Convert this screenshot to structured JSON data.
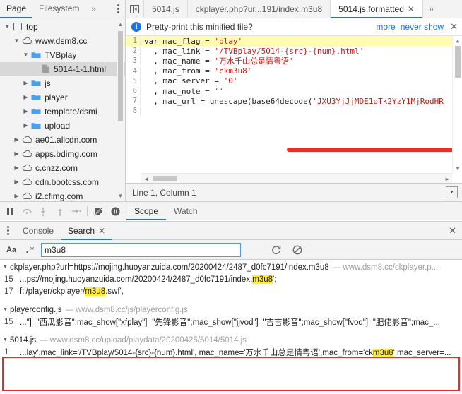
{
  "navigator": {
    "tabs": [
      {
        "label": "Page",
        "active": true
      },
      {
        "label": "Filesystem",
        "active": false
      }
    ],
    "overflow_icon": "chevron-double-right-icon",
    "menu_icon": "kebab-menu-icon",
    "tree": [
      {
        "label": "top",
        "icon": "frame-icon",
        "depth": 0,
        "twisty": "open",
        "selected": false
      },
      {
        "label": "www.dsm8.cc",
        "icon": "cloud-icon",
        "depth": 1,
        "twisty": "open",
        "selected": false
      },
      {
        "label": "TVBplay",
        "icon": "folder-icon",
        "depth": 2,
        "twisty": "open",
        "selected": false
      },
      {
        "label": "5014-1-1.html",
        "icon": "file-icon",
        "depth": 3,
        "twisty": "none",
        "selected": true
      },
      {
        "label": "js",
        "icon": "folder-icon",
        "depth": 2,
        "twisty": "closed",
        "selected": false
      },
      {
        "label": "player",
        "icon": "folder-icon",
        "depth": 2,
        "twisty": "closed",
        "selected": false
      },
      {
        "label": "template/dsmi",
        "icon": "folder-icon",
        "depth": 2,
        "twisty": "closed",
        "selected": false
      },
      {
        "label": "upload",
        "icon": "folder-icon",
        "depth": 2,
        "twisty": "closed",
        "selected": false
      },
      {
        "label": "ae01.alicdn.com",
        "icon": "cloud-icon",
        "depth": 1,
        "twisty": "closed",
        "selected": false
      },
      {
        "label": "apps.bdimg.com",
        "icon": "cloud-icon",
        "depth": 1,
        "twisty": "closed",
        "selected": false
      },
      {
        "label": "c.cnzz.com",
        "icon": "cloud-icon",
        "depth": 1,
        "twisty": "closed",
        "selected": false
      },
      {
        "label": "cdn.bootcss.com",
        "icon": "cloud-icon",
        "depth": 1,
        "twisty": "closed",
        "selected": false
      },
      {
        "label": "i2.cfimg.com",
        "icon": "cloud-icon",
        "depth": 1,
        "twisty": "closed",
        "selected": false
      }
    ]
  },
  "debugger_toolbar": {
    "buttons": [
      {
        "name": "pause-script-execution",
        "icon": "pause-icon",
        "state": "active"
      },
      {
        "name": "step-over-next-function-call",
        "icon": "step-over-icon",
        "state": "disabled"
      },
      {
        "name": "step-into-next-function-call",
        "icon": "step-into-icon",
        "state": "disabled"
      },
      {
        "name": "step-out-of-current-function",
        "icon": "step-out-icon",
        "state": "disabled"
      },
      {
        "name": "step",
        "icon": "step-icon",
        "state": "disabled"
      },
      {
        "name": "deactivate-breakpoints",
        "icon": "breakpoint-slash-icon",
        "state": "active"
      },
      {
        "name": "pause-on-exceptions",
        "icon": "pause-circle-icon",
        "state": "active"
      }
    ]
  },
  "sources": {
    "panel_toggle_icon": "show-navigator-icon",
    "tabs": [
      {
        "label": "5014.js",
        "active": false,
        "closable": false
      },
      {
        "label": "ckplayer.php?ur...191/index.m3u8",
        "active": false,
        "closable": false
      },
      {
        "label": "5014.js:formatted",
        "active": true,
        "closable": true
      }
    ],
    "overflow_icon": "chevron-double-right-icon",
    "infobar": {
      "icon": "info-icon",
      "message": "Pretty-print this minified file?",
      "more_label": "more",
      "never_show_label": "never show",
      "close_icon": "close-icon"
    },
    "code_lines": [
      {
        "no": "1",
        "highlighted": true,
        "text": "var mac_flag = 'play'"
      },
      {
        "no": "2",
        "highlighted": false,
        "text": "  , mac_link = '/TVBplay/5014-{src}-{num}.html'"
      },
      {
        "no": "3",
        "highlighted": false,
        "text": "  , mac_name = '万水千山总是情粤语'"
      },
      {
        "no": "4",
        "highlighted": false,
        "text": "  , mac_from = 'ckm3u8'"
      },
      {
        "no": "5",
        "highlighted": false,
        "text": "  , mac_server = '0'"
      },
      {
        "no": "6",
        "highlighted": false,
        "text": "  , mac_note = ''"
      },
      {
        "no": "7",
        "highlighted": false,
        "text": "  , mac_url = unescape(base64decode('JXU3YjJjMDE1dTk2YzY1MjRodHR"
      },
      {
        "no": "8",
        "highlighted": false,
        "text": ""
      }
    ],
    "status_text": "Line 1, Column 1",
    "status_button_icon": "show-console-drawer-icon"
  },
  "sidepane": {
    "tabs": [
      {
        "label": "Scope",
        "active": true
      },
      {
        "label": "Watch",
        "active": false
      }
    ]
  },
  "drawer": {
    "menu_icon": "kebab-menu-icon",
    "tabs": [
      {
        "label": "Console",
        "active": false,
        "closable": false
      },
      {
        "label": "Search",
        "active": true,
        "closable": true
      }
    ],
    "close_icon": "close-icon",
    "search": {
      "match_case_label": "Aa",
      "regex_label": ".*",
      "value": "m3u8",
      "placeholder": "",
      "refresh_icon": "refresh-icon",
      "clear_icon": "clear-icon"
    },
    "results": [
      {
        "file": "ckplayer.php?url=https://mojing.huoyanzuida.com/20200424/2487_d0fc7191/index.m3u8",
        "url": "www.dsm8.cc/ckplayer.p...",
        "expanded": true,
        "highlighted_box": false,
        "lines": [
          {
            "no": "15",
            "pre": "...ps://mojing.huoyanzuida.com/20200424/2487_d0fc7191/index.",
            "match": "m3u8",
            "post": "';"
          },
          {
            "no": "17",
            "pre": "f:'/player/ckplayer/",
            "match": "m3u8",
            "post": ".swf',"
          }
        ]
      },
      {
        "file": "playerconfig.js",
        "url": "www.dsm8.cc/js/playerconfig.js",
        "expanded": true,
        "highlighted_box": false,
        "lines": [
          {
            "no": "15",
            "pre": "...\"]=\"西瓜影音\";mac_show[\"xfplay\"]=\"先锋影音\";mac_show[\"jjvod\"]=\"吉吉影音\";mac_show[\"fvod\"]=\"肥佬影音\";mac_...",
            "match": "",
            "post": ""
          }
        ]
      },
      {
        "file": "5014.js",
        "url": "www.dsm8.cc/upload/playdata/20200425/5014/5014.js",
        "expanded": true,
        "highlighted_box": true,
        "lines": [
          {
            "no": "1",
            "pre": "...lay',mac_link='/TVBplay/5014-{src}-{num}.html', mac_name='万水千山总是情粤语',mac_from='ck",
            "match": "m3u8",
            "post": "',mac_server=..."
          }
        ]
      }
    ]
  },
  "colors": {
    "accent": "#1a73e8",
    "highlight": "#ffeb3b",
    "annotation_red": "#ee2b24",
    "code_string": "#c41a16",
    "code_keyword": "#000080",
    "line_highlight": "#fffbb0"
  }
}
